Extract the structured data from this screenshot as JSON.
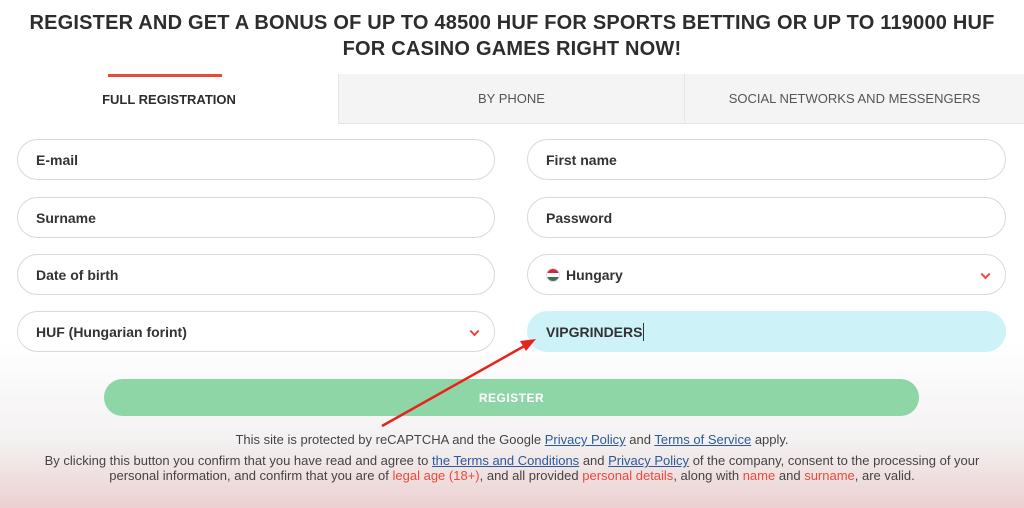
{
  "banner": {
    "title": "REGISTER AND GET A BONUS OF UP TO 48500 HUF FOR SPORTS BETTING OR UP TO 119000 HUF FOR CASINO GAMES RIGHT NOW!"
  },
  "tabs": [
    {
      "label": "FULL REGISTRATION",
      "active": true
    },
    {
      "label": "BY PHONE",
      "active": false
    },
    {
      "label": "SOCIAL NETWORKS AND MESSENGERS",
      "active": false
    }
  ],
  "form": {
    "email_placeholder": "E-mail",
    "first_name_placeholder": "First name",
    "surname_placeholder": "Surname",
    "password_placeholder": "Password",
    "dob_placeholder": "Date of birth",
    "country_value": "Hungary",
    "currency_value": "HUF (Hungarian forint)",
    "promo_value": "VIPGRINDERS",
    "flag_colors": [
      "#cd2a3e",
      "#ffffff",
      "#436f4d"
    ],
    "register_label": "REGISTER"
  },
  "legal": {
    "recaptcha_prefix": "This site is protected by reCAPTCHA and the Google",
    "privacy_policy": "Privacy Policy",
    "and": "and",
    "terms_of_service": "Terms of Service",
    "apply": "apply.",
    "consent_prefix": "By clicking this button you confirm that you have read and agree to",
    "terms_and_conditions": "the Terms and Conditions",
    "and2": "and",
    "privacy_policy_2": "Privacy Policy",
    "consent_mid": "of the company, consent to the processing of your personal information, and confirm that you are of",
    "legal_age": "legal age (18+)",
    "consent_mid2": ", and all provided",
    "personal_details": "personal details",
    "along_with": ", along with",
    "name": "name",
    "and3": "and",
    "surname": "surname",
    "are_valid": ", are valid."
  },
  "colors": {
    "accent": "#e84a3c",
    "register_button": "#8ed6a6",
    "promo_field": "#cdf3f8",
    "link": "#2a5a9e"
  }
}
